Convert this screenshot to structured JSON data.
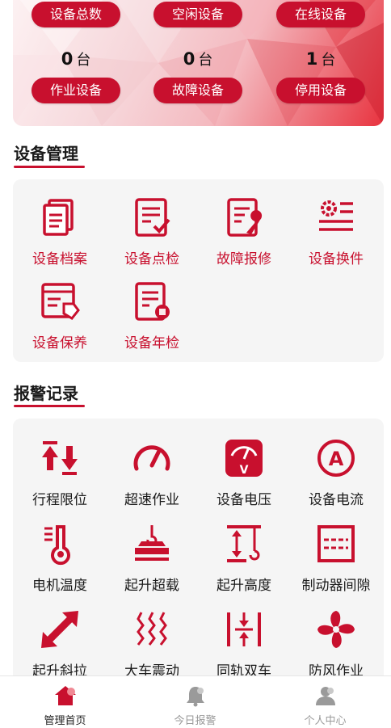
{
  "colors": {
    "accent": "#c8102e",
    "panel_bg": "#f5f5f5"
  },
  "stats": {
    "top_row": [
      {
        "label": "设备总数"
      },
      {
        "label": "空闲设备"
      },
      {
        "label": "在线设备"
      }
    ],
    "bottom_row": [
      {
        "value": "0",
        "unit": "台",
        "label": "作业设备"
      },
      {
        "value": "0",
        "unit": "台",
        "label": "故障设备"
      },
      {
        "value": "1",
        "unit": "台",
        "label": "停用设备"
      }
    ]
  },
  "management": {
    "title": "设备管理",
    "items": [
      {
        "label": "设备档案",
        "icon": "document-archive-icon"
      },
      {
        "label": "设备点检",
        "icon": "checklist-icon"
      },
      {
        "label": "故障报修",
        "icon": "repair-wrench-icon"
      },
      {
        "label": "设备换件",
        "icon": "gear-list-icon"
      },
      {
        "label": "设备保养",
        "icon": "maintenance-tag-icon"
      },
      {
        "label": "设备年检",
        "icon": "annual-inspection-icon"
      }
    ]
  },
  "alarms": {
    "title": "报警记录",
    "items": [
      {
        "label": "行程限位",
        "icon": "travel-limit-icon"
      },
      {
        "label": "超速作业",
        "icon": "speedometer-icon"
      },
      {
        "label": "设备电压",
        "icon": "voltmeter-icon"
      },
      {
        "label": "设备电流",
        "icon": "ammeter-icon"
      },
      {
        "label": "电机温度",
        "icon": "thermometer-icon"
      },
      {
        "label": "起升超载",
        "icon": "hook-overload-icon"
      },
      {
        "label": "起升高度",
        "icon": "lift-height-icon"
      },
      {
        "label": "制动器间隙",
        "icon": "brake-gap-icon"
      },
      {
        "label": "起升斜拉",
        "icon": "diagonal-arrow-icon"
      },
      {
        "label": "大车震动",
        "icon": "vibration-icon"
      },
      {
        "label": "同轨双车",
        "icon": "same-track-icon"
      },
      {
        "label": "防风作业",
        "icon": "fan-icon"
      }
    ]
  },
  "tabbar": {
    "tabs": [
      {
        "label": "管理首页",
        "icon": "home-icon",
        "active": true
      },
      {
        "label": "今日报警",
        "icon": "bell-icon",
        "active": false
      },
      {
        "label": "个人中心",
        "icon": "user-icon",
        "active": false
      }
    ]
  }
}
